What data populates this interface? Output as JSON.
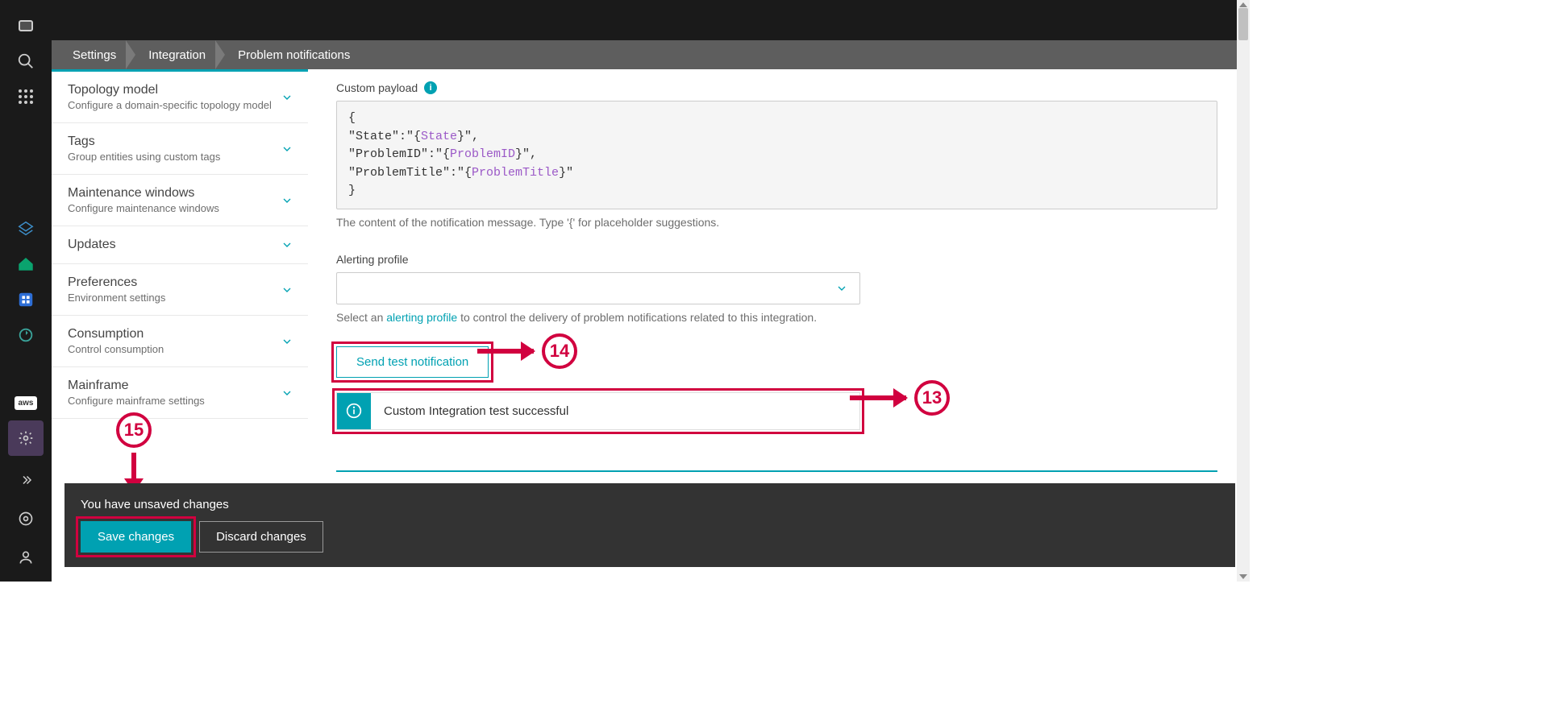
{
  "breadcrumb": {
    "a": "Settings",
    "b": "Integration",
    "c": "Problem notifications"
  },
  "sidebar": {
    "items": [
      {
        "title": "Topology model",
        "sub": "Configure a domain-specific topology model"
      },
      {
        "title": "Tags",
        "sub": "Group entities using custom tags"
      },
      {
        "title": "Maintenance windows",
        "sub": "Configure maintenance windows"
      },
      {
        "title": "Updates",
        "sub": ""
      },
      {
        "title": "Preferences",
        "sub": "Environment settings"
      },
      {
        "title": "Consumption",
        "sub": "Control consumption"
      },
      {
        "title": "Mainframe",
        "sub": "Configure mainframe settings"
      }
    ]
  },
  "form": {
    "payload_label": "Custom payload",
    "payload_lines": {
      "l0": "{",
      "l1a": "\"State\":\"{",
      "l1t": "State",
      "l1b": "}\",",
      "l2a": "\"ProblemID\":\"{",
      "l2t": "ProblemID",
      "l2b": "}\",",
      "l3a": "\"ProblemTitle\":\"{",
      "l3t": "ProblemTitle",
      "l3b": "}\"",
      "l4": "}"
    },
    "payload_help": "The content of the notification message. Type '{' for placeholder suggestions.",
    "alerting_label": "Alerting profile",
    "alerting_help_prefix": "Select an ",
    "alerting_help_link": "alerting profile",
    "alerting_help_suffix": " to control the delivery of problem notifications related to this integration.",
    "test_btn": "Send test notification",
    "success_msg": "Custom Integration test successful"
  },
  "callouts": {
    "c13": "13",
    "c14": "14",
    "c15": "15"
  },
  "unsaved": {
    "text": "You have unsaved changes",
    "save": "Save changes",
    "discard": "Discard changes"
  },
  "iconbar": {
    "aws": "aws"
  }
}
